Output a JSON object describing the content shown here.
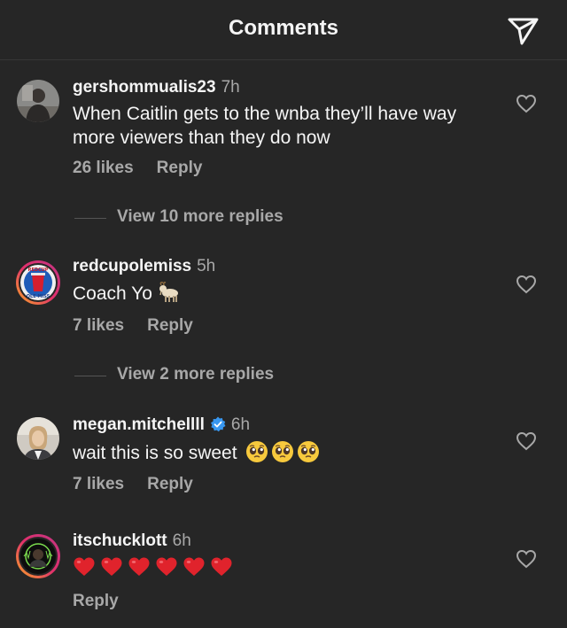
{
  "header": {
    "title": "Comments",
    "send_icon": "paper-plane-icon"
  },
  "comments": [
    {
      "username": "gershommualis23",
      "time": "7h",
      "text": "When Caitlin gets to the wnba they’ll have way more viewers than they do now",
      "likes": "26 likes",
      "reply": "Reply",
      "view_more": "View 10 more replies"
    },
    {
      "username": "redcupolemiss",
      "time": "5h",
      "text": "Coach Yo",
      "text_emoji": "goat",
      "likes": "7 likes",
      "reply": "Reply",
      "view_more": "View 2 more replies",
      "avatar_text_top": "REDCUP",
      "avatar_text_bottom": "OLE MISS"
    },
    {
      "username": "megan.mitchellll",
      "verified": true,
      "time": "6h",
      "text": "wait this is so sweet",
      "text_emoji": "pleading-face x3",
      "likes": "7 likes",
      "reply": "Reply"
    },
    {
      "username": "itschucklott",
      "time": "6h",
      "text_emoji": "red-heart x6",
      "reply": "Reply"
    }
  ],
  "colors": {
    "background": "#262626",
    "text": "#f5f5f5",
    "secondary": "#a8a8a8",
    "verified": "#3897f0",
    "heart": "#e0232c"
  }
}
